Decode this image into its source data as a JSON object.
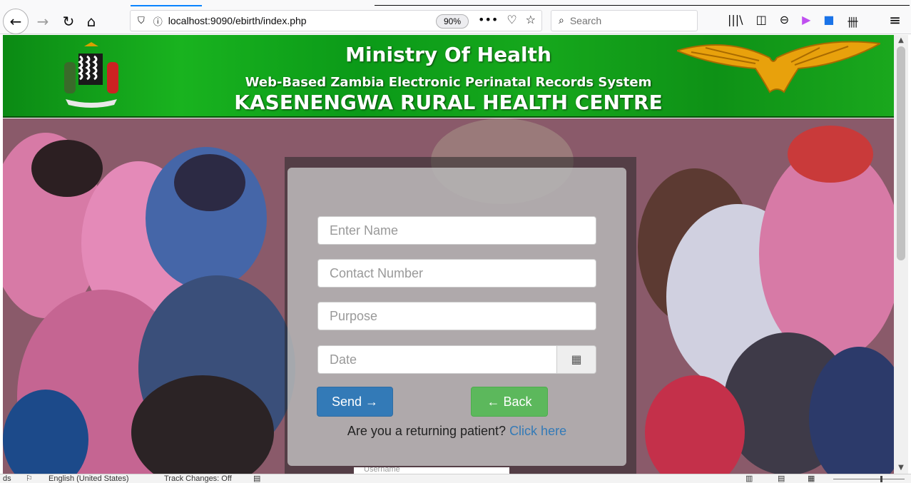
{
  "browser": {
    "url": "localhost:9090/ebirth/index.php",
    "zoom": "90%",
    "search_placeholder": "Search",
    "more_icon": "•••",
    "pocket_icon": "♡",
    "star_icon": "☆"
  },
  "header": {
    "title": "Ministry Of Health",
    "subtitle": "Web-Based Zambia Electronic Perinatal Records System",
    "facility": "KASENENGWA RURAL HEALTH CENTRE"
  },
  "form": {
    "name_placeholder": "Enter Name",
    "contact_placeholder": "Contact Number",
    "purpose_placeholder": "Purpose",
    "date_placeholder": "Date",
    "send_label": "Send →",
    "back_label": "← Back",
    "returning_text": "Are you a returning patient?",
    "click_here": "Click here",
    "username_peek": "Username"
  },
  "status_bar": {
    "left": "ds",
    "language": "English (United States)",
    "track_changes": "Track Changes: Off"
  },
  "colors": {
    "banner_green": "#16a81c",
    "send_blue": "#337ab7",
    "back_green": "#5cb85c",
    "link_blue": "#337ab7"
  }
}
